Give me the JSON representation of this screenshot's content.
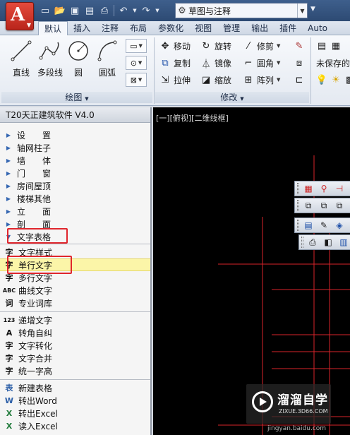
{
  "titlebar": {
    "workspace": "草图与注释",
    "qat_icons": [
      "new-icon",
      "open-icon",
      "save-icon",
      "saveas-icon",
      "print-icon",
      "undo-icon",
      "redo-icon"
    ]
  },
  "tabs": [
    "默认",
    "插入",
    "注释",
    "布局",
    "参数化",
    "视图",
    "管理",
    "输出",
    "插件",
    "Auto"
  ],
  "ribbon": {
    "draw": {
      "title": "绘图",
      "line": "直线",
      "polyline": "多段线",
      "circle": "圆",
      "arc": "圆弧"
    },
    "modify": {
      "title": "修改",
      "move": "移动",
      "rotate": "旋转",
      "trim": "修剪",
      "copy": "复制",
      "mirror": "镜像",
      "fillet": "圆角",
      "stretch": "拉伸",
      "scale": "缩放",
      "array": "阵列"
    },
    "layer": {
      "unsaved": "未保存的"
    }
  },
  "palette": {
    "title": "T20天正建筑软件 V4.0",
    "categories": [
      "设　　置",
      "轴网柱子",
      "墙　　体",
      "门　　窗",
      "房间屋顶",
      "楼梯其他",
      "立　　面",
      "剖　　面",
      "文字表格"
    ],
    "commands_group1": [
      {
        "icon": "字",
        "label": "文字样式"
      },
      {
        "icon": "字",
        "label": "单行文字"
      },
      {
        "icon": "字",
        "label": "多行文字"
      },
      {
        "icon": "ABC",
        "label": "曲线文字"
      },
      {
        "icon": "词",
        "label": "专业词库"
      }
    ],
    "commands_group2": [
      {
        "icon": "123",
        "label": "递增文字"
      },
      {
        "icon": "A",
        "label": "转角自纠"
      },
      {
        "icon": "字",
        "label": "文字转化"
      },
      {
        "icon": "字",
        "label": "文字合并"
      },
      {
        "icon": "字",
        "label": "统一字高"
      }
    ],
    "commands_group3": [
      {
        "icon": "表",
        "label": "新建表格"
      },
      {
        "icon": "W",
        "label": "转出Word"
      },
      {
        "icon": "X",
        "label": "转出Excel"
      },
      {
        "icon": "X",
        "label": "读入Excel"
      }
    ]
  },
  "canvas": {
    "view_label": "[一][俯视][二维线框]",
    "watermark_title": "溜溜自学",
    "watermark_url": "ZIXUE.3D66.COM",
    "watermark_bottom": "jingyan.baidu.com"
  },
  "colors": {
    "accent_red": "#e0262d",
    "selection": "#fbf5a8",
    "canvas_bg": "#000000",
    "drawing_line": "#d8232a"
  }
}
